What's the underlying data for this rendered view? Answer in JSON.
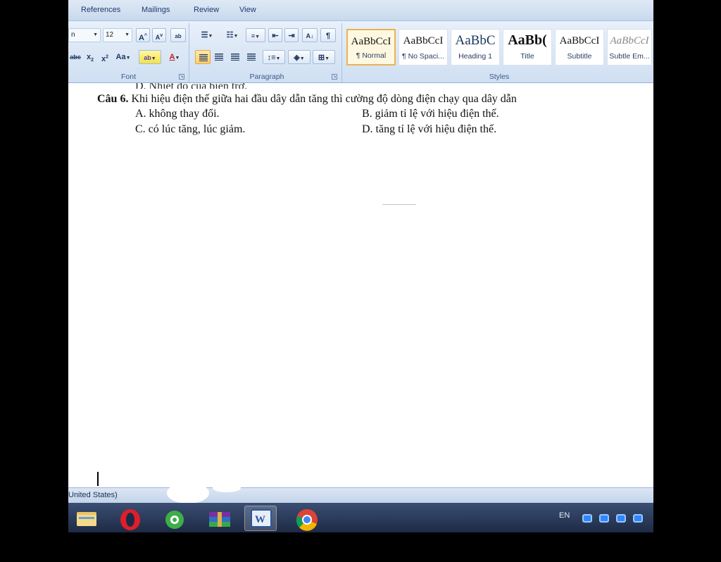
{
  "ribbon": {
    "tabs": [
      "References",
      "Mailings",
      "Review",
      "View"
    ],
    "font": {
      "name_value": "n",
      "size_value": "12",
      "group_label": "Font"
    },
    "paragraph": {
      "group_label": "Paragraph"
    },
    "styles": {
      "group_label": "Styles",
      "items": [
        {
          "sample": "AaBbCcI",
          "name": "¶ Normal"
        },
        {
          "sample": "AaBbCcI",
          "name": "¶ No Spaci..."
        },
        {
          "sample": "AaBbC",
          "name": "Heading 1"
        },
        {
          "sample": "AaBb(",
          "name": "Title"
        },
        {
          "sample": "AaBbCcI",
          "name": "Subtitle"
        },
        {
          "sample": "AaBbCcI",
          "name": "Subtle Em..."
        }
      ]
    }
  },
  "document": {
    "cut_line": "D. Nhiệt độ của biến trở.",
    "question": {
      "number": "Câu 6.",
      "text": "Khi hiệu điện thế giữa hai đầu dây dẫn tăng thì cường độ dòng điện chạy qua dây dẫn"
    },
    "options": {
      "a": "A. không thay đổi.",
      "b": "B. giảm tỉ lệ với hiệu điện thế.",
      "c": "C. có lúc tăng, lúc giảm.",
      "d": "D. tăng tỉ lệ với hiệu điện thế."
    }
  },
  "statusbar": {
    "language": "United States)"
  },
  "taskbar": {
    "apps": [
      "file-explorer",
      "opera",
      "coccoc",
      "winrar",
      "word",
      "chrome"
    ],
    "active_app": "word",
    "input_language": "EN"
  },
  "colors": {
    "ribbon_bg": "#dce8f6",
    "selected_style_border": "#e8b454",
    "taskbar_bg": "#1d2a45",
    "word_blue": "#2b579a"
  }
}
